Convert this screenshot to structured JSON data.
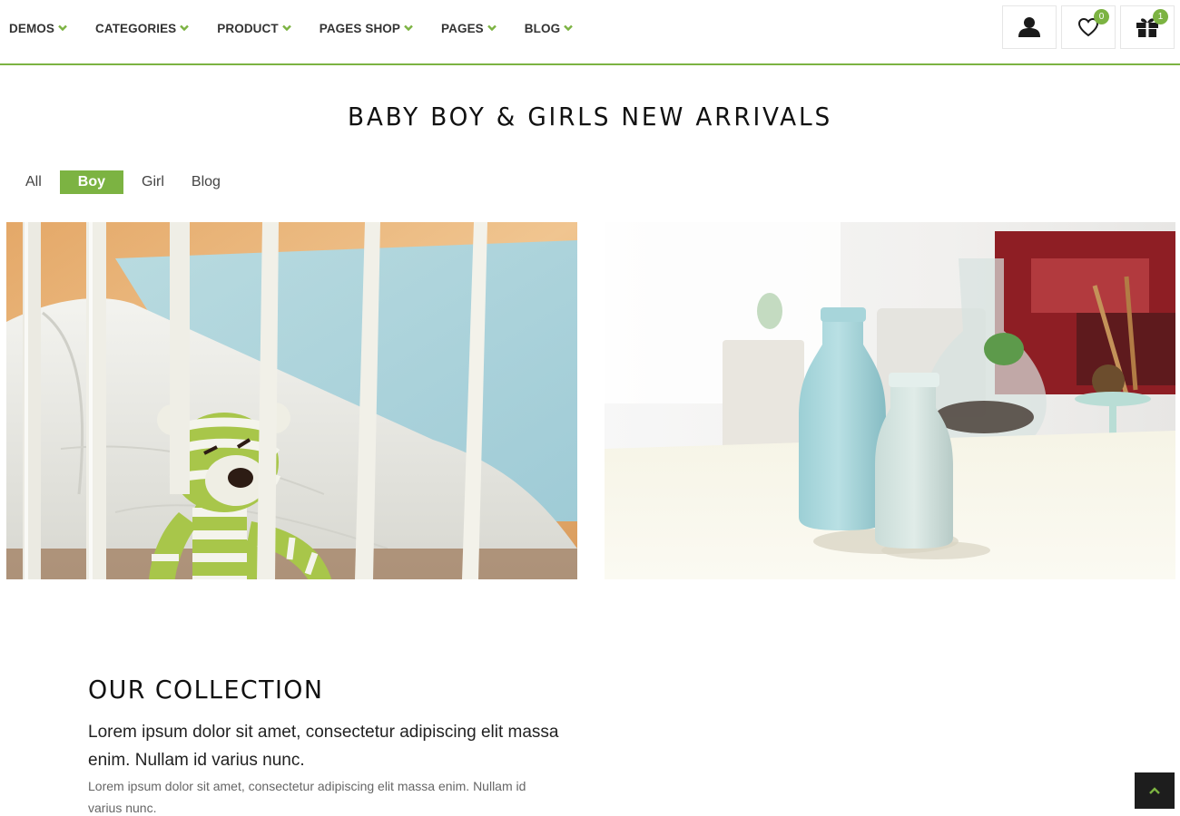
{
  "nav": {
    "items": [
      {
        "label": "DEMOS"
      },
      {
        "label": "CATEGORIES"
      },
      {
        "label": "PRODUCT"
      },
      {
        "label": "PAGES SHOP"
      },
      {
        "label": "PAGES"
      },
      {
        "label": "BLOG"
      }
    ],
    "accent_color": "#7cb342"
  },
  "header_icons": {
    "account": {
      "icon": "user-icon"
    },
    "wishlist": {
      "icon": "heart-icon",
      "count": "0"
    },
    "cart": {
      "icon": "gift-icon",
      "count": "1"
    }
  },
  "section": {
    "title": "BABY BOY & GIRLS NEW ARRIVALS"
  },
  "filters": {
    "tabs": [
      {
        "label": "All"
      },
      {
        "label": "Boy",
        "active": true
      },
      {
        "label": "Girl"
      },
      {
        "label": "Blog"
      }
    ]
  },
  "gallery": {
    "images": [
      {
        "subject": "knitted green striped teddy bear in white crib"
      },
      {
        "subject": "two pastel blue ceramic bottles on white table"
      }
    ]
  },
  "collection": {
    "title": "OUR COLLECTION",
    "lead": "Lorem ipsum dolor sit amet, consectetur adipiscing elit massa enim. Nullam id varius nunc.",
    "body": "Lorem ipsum dolor sit amet, consectetur adipiscing elit massa enim. Nullam id varius nunc."
  },
  "back_to_top": {
    "icon": "chevron-up-icon"
  }
}
